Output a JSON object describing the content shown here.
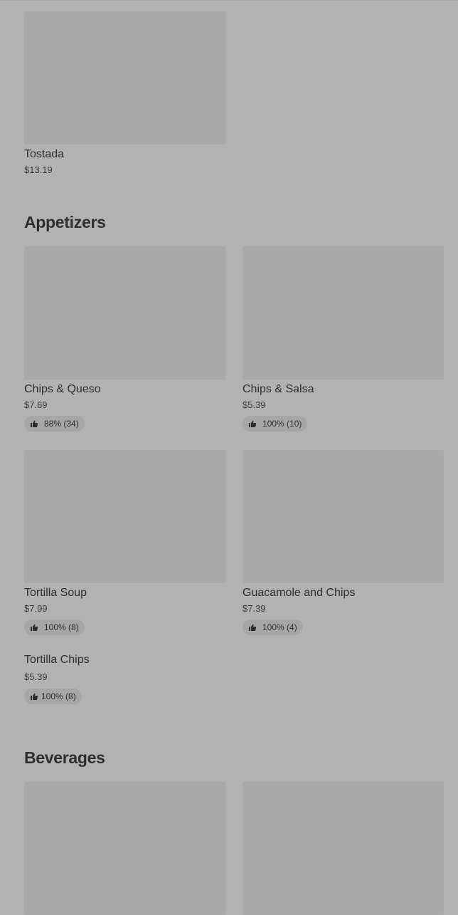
{
  "sections": [
    {
      "title": "",
      "items": [
        {
          "name": "Tostada",
          "price": "$13.19"
        }
      ]
    },
    {
      "title": "Appetizers",
      "items": [
        {
          "name": "Chips & Queso",
          "price": "$7.69",
          "rating": "88% (34)"
        },
        {
          "name": "Chips & Salsa",
          "price": "$5.39",
          "rating": "100% (10)"
        },
        {
          "name": "Tortilla Soup",
          "price": "$7.99",
          "rating": "100% (8)"
        },
        {
          "name": "Guacamole and Chips",
          "price": "$7.39",
          "rating": "100% (4)"
        },
        {
          "name": "Tortilla Chips",
          "price": "$5.39",
          "rating": "100% (8)"
        }
      ]
    },
    {
      "title": "Beverages",
      "items": []
    }
  ],
  "icons": {
    "rating": "thumbs-up-icon"
  }
}
